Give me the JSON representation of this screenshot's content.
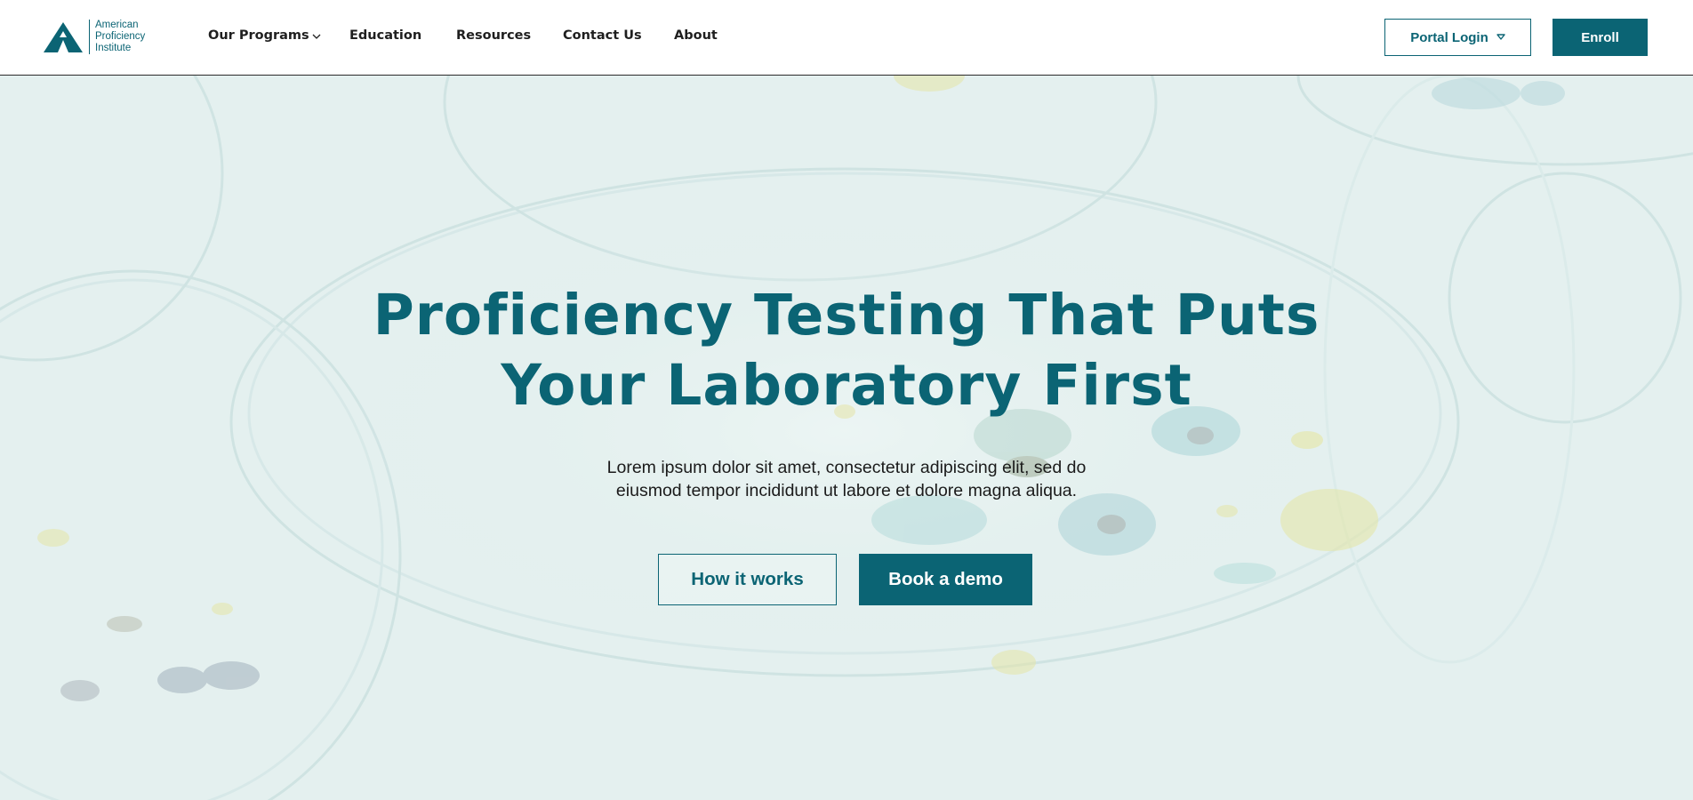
{
  "brand": {
    "name_lines": [
      "American",
      "Proficiency",
      "Institute"
    ],
    "logo_icon": "mountain-peak-logo",
    "primary_color": "#0b6474"
  },
  "nav": {
    "items": [
      {
        "label": "Our Programs",
        "has_dropdown": true
      },
      {
        "label": "Education"
      },
      {
        "label": "Resources"
      },
      {
        "label": "Contact Us"
      },
      {
        "label": "About"
      }
    ],
    "portal_login": "Portal Login",
    "enroll": "Enroll"
  },
  "hero": {
    "title_line1": "Proficiency Testing That Puts",
    "title_line2": "Your Laboratory First",
    "subtitle_line1": "Lorem ipsum dolor sit amet, consectetur adipiscing elit, sed do",
    "subtitle_line2": "eiusmod tempor incididunt ut labore et dolore magna aliqua.",
    "secondary_cta": "How it works",
    "primary_cta": "Book a demo",
    "background": "petri-dishes-photo"
  }
}
